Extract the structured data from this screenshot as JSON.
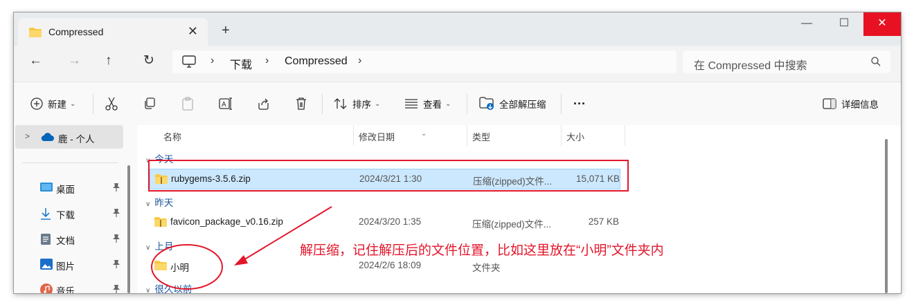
{
  "window": {
    "tab_title": "Compressed",
    "tab_close": "✕",
    "new_tab": "+",
    "buttons": {
      "minimize": "—",
      "maximize": "☐",
      "close": "✕"
    }
  },
  "nav": {
    "back": "←",
    "forward": "→",
    "up": "↑",
    "refresh": "↻",
    "breadcrumb": [
      "下载",
      "Compressed"
    ],
    "sep": "›",
    "search_placeholder": "在 Compressed 中搜索"
  },
  "toolbar": {
    "new_label": "新建",
    "sort_label": "排序",
    "view_label": "查看",
    "extract_all_label": "全部解压缩",
    "more_label": "···",
    "details_label": "详细信息",
    "chevron": "⌄"
  },
  "sidebar": {
    "onedrive_label": "鹿 - 个人",
    "items": [
      {
        "label": "桌面",
        "icon": "desktop-icon"
      },
      {
        "label": "下载",
        "icon": "download-icon"
      },
      {
        "label": "文档",
        "icon": "document-icon"
      },
      {
        "label": "图片",
        "icon": "pictures-icon"
      },
      {
        "label": "音乐",
        "icon": "music-icon"
      }
    ]
  },
  "columns": {
    "name": "名称",
    "date": "修改日期",
    "type": "类型",
    "size": "大小"
  },
  "groups": [
    {
      "label": "今天",
      "files": [
        {
          "name": "rubygems-3.5.6.zip",
          "date": "2024/3/21 1:30",
          "type": "压缩(zipped)文件...",
          "size": "15,071 KB",
          "kind": "zip",
          "selected": true
        }
      ]
    },
    {
      "label": "昨天",
      "files": [
        {
          "name": "favicon_package_v0.16.zip",
          "date": "2024/3/20 1:35",
          "type": "压缩(zipped)文件...",
          "size": "257 KB",
          "kind": "zip",
          "selected": false
        }
      ]
    },
    {
      "label": "上月",
      "files": [
        {
          "name": "小明",
          "date": "2024/2/6 18:09",
          "type": "文件夹",
          "size": "",
          "kind": "folder",
          "selected": false
        }
      ]
    },
    {
      "label": "很久以前",
      "files": []
    }
  ],
  "annotation": {
    "text": "解压缩，记住解压后的文件位置，比如这里放在“小明”文件夹内",
    "color": "#e3162b"
  },
  "colors": {
    "accent": "#0067c0",
    "selection": "#cce8ff",
    "folder": "#f8c846",
    "annotation": "#e3162b"
  }
}
